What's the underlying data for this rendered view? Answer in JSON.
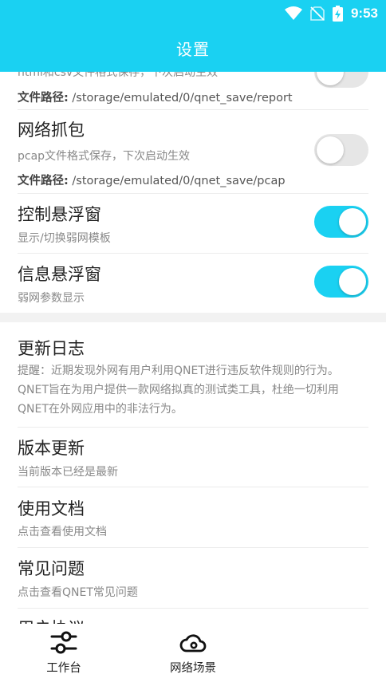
{
  "header": {
    "title": "设置"
  },
  "status_bar": {
    "time": "9:53"
  },
  "settings": {
    "partial_item": {
      "subtitle": "html和csv文件格式保存，下次启动生效",
      "path_label": "文件路径:",
      "path_value": " /storage/emulated/0/qnet_save/report",
      "toggle_on": false
    },
    "packet_capture": {
      "title": "网络抓包",
      "subtitle": "pcap文件格式保存，下次启动生效",
      "path_label": "文件路径:",
      "path_value": " /storage/emulated/0/qnet_save/pcap",
      "toggle_on": false
    },
    "control_float": {
      "title": "控制悬浮窗",
      "subtitle": "显示/切换弱网模板",
      "toggle_on": true
    },
    "info_float": {
      "title": "信息悬浮窗",
      "subtitle": "弱网参数显示",
      "toggle_on": true
    },
    "changelog": {
      "title": "更新日志",
      "description": "提醒：近期发现外网有用户利用QNET进行违反软件规则的行为。QNET旨在为用户提供一款网络拟真的测试类工具，杜绝一切利用QNET在外网应用中的非法行为。"
    },
    "version_update": {
      "title": "版本更新",
      "subtitle": "当前版本已经是最新"
    },
    "docs": {
      "title": "使用文档",
      "subtitle": "点击查看使用文档"
    },
    "faq": {
      "title": "常见问题",
      "subtitle": "点击查看QNET常见问题"
    },
    "partial_bottom": {
      "title": "用户协议"
    }
  },
  "bottom_nav": {
    "workbench": {
      "label": "工作台",
      "icon": "sliders-icon"
    },
    "scenes": {
      "label": "网络场景",
      "icon": "cloud-icon"
    }
  },
  "colors": {
    "accent": "#1ad1f2",
    "toggle_off": "#e6e6e6"
  }
}
